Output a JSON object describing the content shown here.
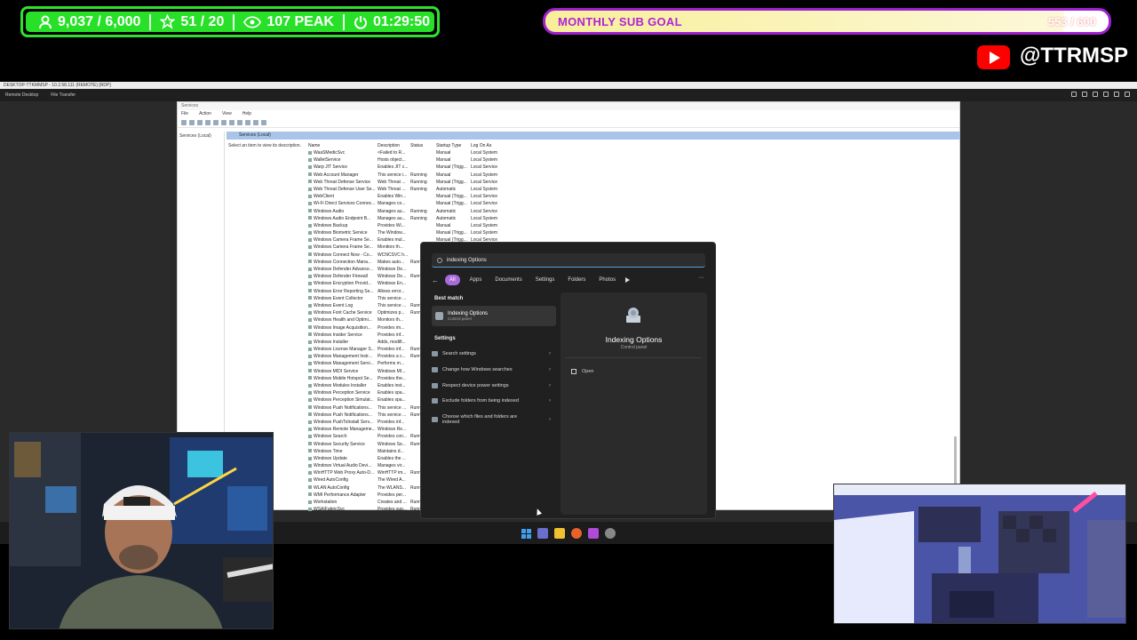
{
  "overlay": {
    "stats": {
      "followers": "9,037 / 6,000",
      "stars": "51 / 20",
      "viewers": "107 PEAK",
      "timer": "01:29:50"
    },
    "sub_goal": {
      "label": "MONTHLY SUB GOAL",
      "count": "553 / 600",
      "progress": 0.92
    },
    "channel": {
      "handle": "@TTRMSP"
    }
  },
  "remote_desktop": {
    "title": "DESKTOP-TTKMMSP - 10.2.58.111 (REMOTE) [RDP]",
    "tabs": [
      "Remote Desktop",
      "File Transfer"
    ]
  },
  "services": {
    "window_title": "Services",
    "menu": [
      "File",
      "Action",
      "View",
      "Help"
    ],
    "tree_item": "Services (Local)",
    "panel_title": "Services (Local)",
    "description_hint": "Select an item to view its description.",
    "columns": [
      "Name",
      "Description",
      "Status",
      "Startup Type",
      "Log On As"
    ],
    "rows": [
      [
        "WaaSMedicSvc",
        "<Failed to R...",
        "",
        "Manual",
        "Local System"
      ],
      [
        "WalletService",
        "Hosts object...",
        "",
        "Manual",
        "Local System"
      ],
      [
        "Warp JIT Service",
        "Enables JIT c...",
        "",
        "Manual (Trigg...",
        "Local Service"
      ],
      [
        "Web Account Manager",
        "This service i...",
        "Running",
        "Manual",
        "Local System"
      ],
      [
        "Web Threat Defense Service",
        "Web Threat ...",
        "Running",
        "Manual (Trigg...",
        "Local Service"
      ],
      [
        "Web Threat Defense User Se...",
        "Web Threat ...",
        "Running",
        "Automatic",
        "Local System"
      ],
      [
        "WebClient",
        "Enables Win...",
        "",
        "Manual (Trigg...",
        "Local Service"
      ],
      [
        "Wi-Fi Direct Services Connec...",
        "Manages co...",
        "",
        "Manual (Trigg...",
        "Local Service"
      ],
      [
        "Windows Audio",
        "Manages au...",
        "Running",
        "Automatic",
        "Local Service"
      ],
      [
        "Windows Audio Endpoint B...",
        "Manages au...",
        "Running",
        "Automatic",
        "Local System"
      ],
      [
        "Windows Backup",
        "Provides Wi...",
        "",
        "Manual",
        "Local System"
      ],
      [
        "Windows Biometric Service",
        "The Window...",
        "",
        "Manual (Trigg...",
        "Local System"
      ],
      [
        "Windows Camera Frame Se...",
        "Enables mul...",
        "",
        "Manual (Trigg...",
        "Local Service"
      ],
      [
        "Windows Camera Frame Se...",
        "Monitors th...",
        "",
        "Manual (Trigg...",
        "Local System"
      ],
      [
        "Windows Connect Now - Co...",
        "WCNCSVC h...",
        "",
        "Manual",
        "Local Service"
      ],
      [
        "Windows Connection Mana...",
        "Makes auto...",
        "Running",
        "Automatic (Tri...",
        "Local Service"
      ],
      [
        "Windows Defender Advance...",
        "Windows De...",
        "",
        "Manual",
        "Local System"
      ],
      [
        "Windows Defender Firewall",
        "Windows De...",
        "Running",
        "Automatic",
        "Local Service"
      ],
      [
        "Windows Encryption Provid...",
        "Windows En...",
        "",
        "Manual (Trigg...",
        "Local Service"
      ],
      [
        "Windows Error Reporting Se...",
        "Allows error...",
        "",
        "Manual (Trigg...",
        "Local System"
      ],
      [
        "Windows Event Collector",
        "This service ...",
        "",
        "Manual",
        "Network Service"
      ],
      [
        "Windows Event Log",
        "This service ...",
        "Running",
        "Automatic",
        "Local Service"
      ],
      [
        "Windows Font Cache Service",
        "Optimizes p...",
        "Running",
        "Automatic",
        "Local Service"
      ],
      [
        "Windows Health and Optimi...",
        "Monitors th...",
        "",
        "Manual",
        "Local System"
      ],
      [
        "Windows Image Acquisition...",
        "Provides im...",
        "",
        "Manual (Trigg...",
        "Local Service"
      ],
      [
        "Windows Insider Service",
        "Provides inf...",
        "",
        "Manual (Trigg...",
        "Local System"
      ],
      [
        "Windows Installer",
        "Adds, modifi...",
        "",
        "Manual",
        "Local System"
      ],
      [
        "Windows License Manager S...",
        "Provides inf...",
        "Running",
        "Manual (Trigg...",
        "Local Service"
      ],
      [
        "Windows Management Instr...",
        "Provides a c...",
        "Running",
        "Automatic",
        "Local System"
      ],
      [
        "Windows Management Servi...",
        "Performs m...",
        "",
        "Manual",
        "Local System"
      ],
      [
        "Windows MIDI Service",
        "Windows MI...",
        "",
        "Manual",
        "Local System"
      ],
      [
        "Windows Mobile Hotspot Se...",
        "Provides the...",
        "",
        "Manual (Trigg...",
        "Local Service"
      ],
      [
        "Windows Modules Installer",
        "Enables inst...",
        "",
        "Manual",
        "Local System"
      ],
      [
        "Windows Perception Service",
        "Enables spa...",
        "",
        "Manual (Trigg...",
        "Local Service"
      ],
      [
        "Windows Perception Simulat...",
        "Enables spa...",
        "",
        "Manual",
        "Local System"
      ],
      [
        "Windows Push Notifications...",
        "This service ...",
        "Running",
        "Automatic",
        "Local System"
      ],
      [
        "Windows Push Notifications...",
        "This service ...",
        "Running",
        "Automatic",
        "Local System"
      ],
      [
        "Windows PushToInstall Serv...",
        "Provides inf...",
        "",
        "Manual (Trigg...",
        "Local System"
      ],
      [
        "Windows Remote Manageme...",
        "Windows Re...",
        "",
        "Manual",
        "Network Service"
      ],
      [
        "Windows Search",
        "Provides con...",
        "Running",
        "Automatic (De...",
        "Local System"
      ],
      [
        "Windows Security Service",
        "Windows Se...",
        "Running",
        "Manual",
        "Local System"
      ],
      [
        "Windows Time",
        "Maintains d...",
        "",
        "Manual (Trigg...",
        "Local Service"
      ],
      [
        "Windows Update",
        "Enables the ...",
        "",
        "Manual (Trigg...",
        "Local System"
      ],
      [
        "Windows Virtual Audio Devi...",
        "Manages vir...",
        "",
        "Manual",
        "Local System"
      ],
      [
        "WinHTTP Web Proxy Auto-D...",
        "WinHTTP im...",
        "Running",
        "Manual",
        "Local Service"
      ],
      [
        "Wired AutoConfig",
        "The Wired A...",
        "",
        "Manual",
        "Local System"
      ],
      [
        "WLAN AutoConfig",
        "The WLANS...",
        "Running",
        "Automatic",
        "Local System"
      ],
      [
        "WMI Performance Adapter",
        "Provides per...",
        "",
        "Manual",
        "Local System"
      ],
      [
        "Workstation",
        "Creates and ...",
        "Running",
        "Automatic",
        "Network Service"
      ],
      [
        "WSAIFabricSvc",
        "Provides sup...",
        "Running",
        "Automatic",
        "Local System"
      ]
    ]
  },
  "search": {
    "query": "indexing Options",
    "filters": [
      "All",
      "Apps",
      "Documents",
      "Settings",
      "Folders",
      "Photos"
    ],
    "best_match_label": "Best match",
    "best_match": {
      "title": "Indexing Options",
      "subtitle": "Control panel"
    },
    "settings_label": "Settings",
    "settings_items": [
      "Search settings",
      "Change how Windows searches",
      "Respect device power settings",
      "Exclude folders from being indexed",
      "Choose which files and folders are indexed"
    ],
    "preview": {
      "title": "Indexing Options",
      "subtitle": "Control panel",
      "action": "Open"
    }
  },
  "colors": {
    "stats_green": "#28e028",
    "goal_purple": "#a020d0",
    "accent": "#a86bd9",
    "youtube_red": "#ff0000"
  }
}
